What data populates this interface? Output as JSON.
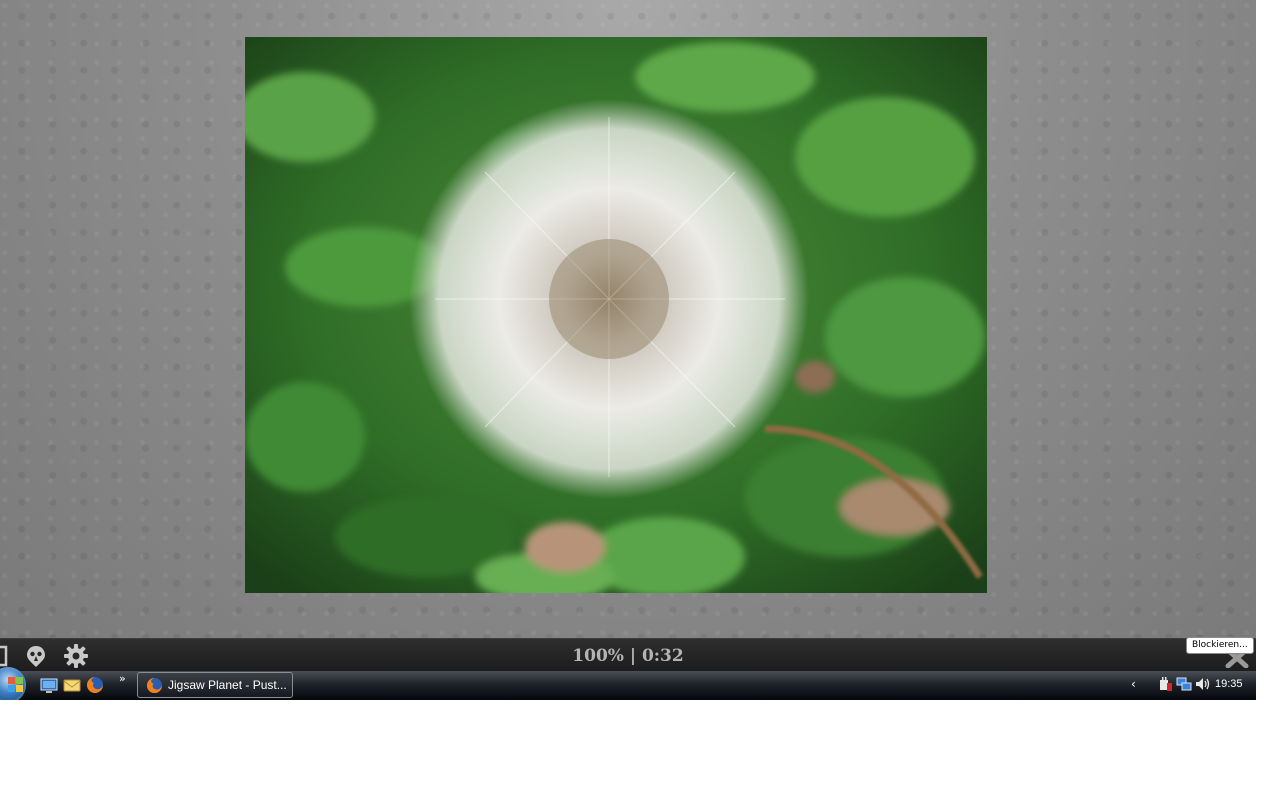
{
  "toolbar": {
    "progress": "100% | 0:32",
    "tooltip": "Blockieren...",
    "icons": [
      "box-icon",
      "ghost-icon",
      "gear-icon",
      "close-icon"
    ]
  },
  "taskbar": {
    "task_label": "Jigsaw Planet - Pust...",
    "clock": "19:35",
    "quick_launch": [
      "show-desktop-icon",
      "mail-icon",
      "firefox-icon"
    ],
    "tray": [
      "power-icon",
      "network-icon",
      "volume-icon"
    ]
  },
  "colors": {
    "toolbar_bg": "#232323",
    "progress_text": "#b4b4b4",
    "taskbar_bg": "#0f1217"
  }
}
